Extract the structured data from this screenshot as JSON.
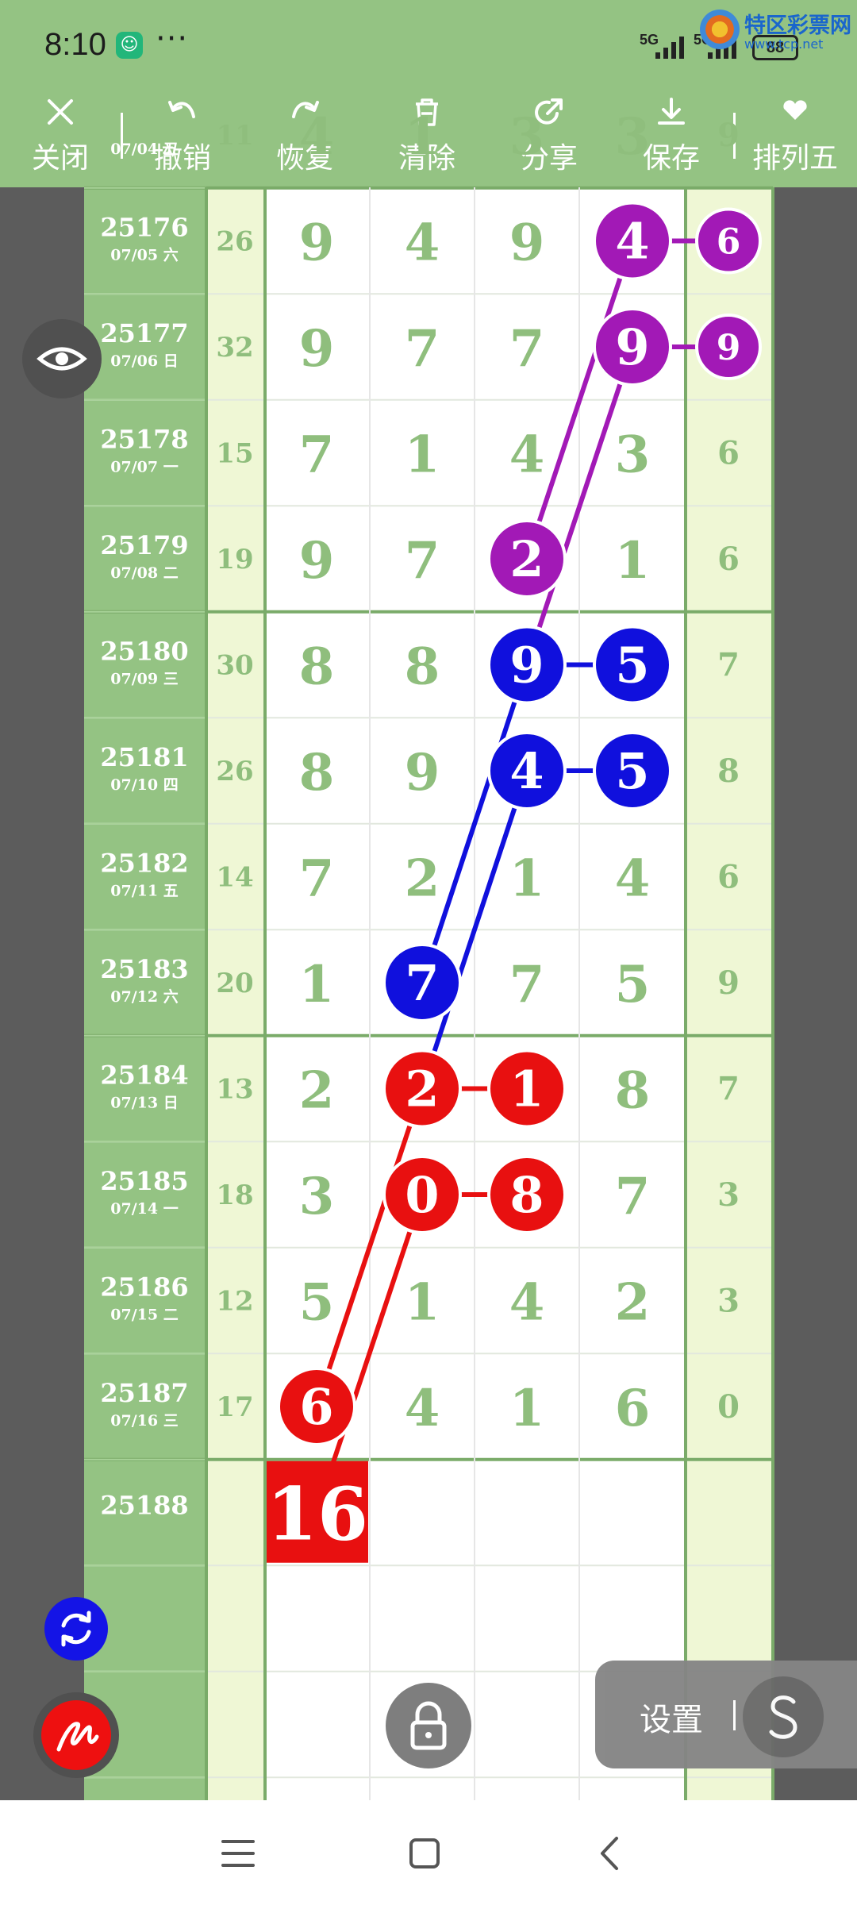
{
  "status_bar": {
    "time": "8:10",
    "network_1": "5G",
    "network_2": "5G",
    "battery": "88"
  },
  "watermark": {
    "brand": "特区彩票网",
    "url": "www.tcp.net"
  },
  "toolbar": {
    "close": "关闭",
    "undo": "撤销",
    "redo": "恢复",
    "clear": "清除",
    "share": "分享",
    "save": "保存",
    "sort": "排列五"
  },
  "table": {
    "rows": [
      {
        "period": "",
        "date": "07/04 五",
        "sum": "11",
        "digits": [
          "4",
          "1",
          "3",
          "3"
        ],
        "fifth": "9"
      },
      {
        "period": "25176",
        "date": "07/05 六",
        "sum": "26",
        "digits": [
          "9",
          "4",
          "9",
          "4"
        ],
        "fifth": "6"
      },
      {
        "period": "25177",
        "date": "07/06 日",
        "sum": "32",
        "digits": [
          "9",
          "7",
          "7",
          "9"
        ],
        "fifth": "9"
      },
      {
        "period": "25178",
        "date": "07/07 一",
        "sum": "15",
        "digits": [
          "7",
          "1",
          "4",
          "3"
        ],
        "fifth": "6"
      },
      {
        "period": "25179",
        "date": "07/08 二",
        "sum": "19",
        "digits": [
          "9",
          "7",
          "2",
          "1"
        ],
        "fifth": "6"
      },
      {
        "period": "25180",
        "date": "07/09 三",
        "sum": "30",
        "digits": [
          "8",
          "8",
          "9",
          "5"
        ],
        "fifth": "7"
      },
      {
        "period": "25181",
        "date": "07/10 四",
        "sum": "26",
        "digits": [
          "8",
          "9",
          "4",
          "5"
        ],
        "fifth": "8"
      },
      {
        "period": "25182",
        "date": "07/11 五",
        "sum": "14",
        "digits": [
          "7",
          "2",
          "1",
          "4"
        ],
        "fifth": "6"
      },
      {
        "period": "25183",
        "date": "07/12 六",
        "sum": "20",
        "digits": [
          "1",
          "7",
          "7",
          "5"
        ],
        "fifth": "9"
      },
      {
        "period": "25184",
        "date": "07/13 日",
        "sum": "13",
        "digits": [
          "2",
          "2",
          "1",
          "8"
        ],
        "fifth": "7"
      },
      {
        "period": "25185",
        "date": "07/14 一",
        "sum": "18",
        "digits": [
          "3",
          "0",
          "8",
          "7"
        ],
        "fifth": "3"
      },
      {
        "period": "25186",
        "date": "07/15 二",
        "sum": "12",
        "digits": [
          "5",
          "1",
          "4",
          "2"
        ],
        "fifth": "3"
      },
      {
        "period": "25187",
        "date": "07/16 三",
        "sum": "17",
        "digits": [
          "6",
          "4",
          "1",
          "6"
        ],
        "fifth": "0"
      },
      {
        "period": "25188",
        "date": "",
        "sum": "",
        "digits": [
          "",
          "",
          "",
          ""
        ],
        "fifth": ""
      }
    ],
    "highlights": [
      {
        "row": 1,
        "col": 3,
        "color": "#a219b6"
      },
      {
        "row": 1,
        "col": 4,
        "color": "#a219b6"
      },
      {
        "row": 2,
        "col": 3,
        "color": "#a219b6"
      },
      {
        "row": 2,
        "col": 4,
        "color": "#a219b6"
      },
      {
        "row": 4,
        "col": 2,
        "color": "#a219b6"
      },
      {
        "row": 5,
        "col": 2,
        "color": "#1010dd"
      },
      {
        "row": 5,
        "col": 3,
        "color": "#1010dd"
      },
      {
        "row": 6,
        "col": 2,
        "color": "#1010dd"
      },
      {
        "row": 6,
        "col": 3,
        "color": "#1010dd"
      },
      {
        "row": 8,
        "col": 1,
        "color": "#1010dd"
      },
      {
        "row": 9,
        "col": 1,
        "color": "#e81010"
      },
      {
        "row": 9,
        "col": 2,
        "color": "#e81010"
      },
      {
        "row": 10,
        "col": 1,
        "color": "#e81010"
      },
      {
        "row": 10,
        "col": 2,
        "color": "#e81010"
      },
      {
        "row": 12,
        "col": 0,
        "color": "#e81010"
      }
    ],
    "prediction": {
      "value": "16",
      "color": "#e81010"
    }
  },
  "settings": {
    "label": "设置"
  },
  "colors": {
    "bar": "#94c383",
    "side_column": "#eff7d5",
    "digit": "#8fbe7d",
    "purple": "#a219b6",
    "blue": "#1010dd",
    "red": "#e81010"
  }
}
